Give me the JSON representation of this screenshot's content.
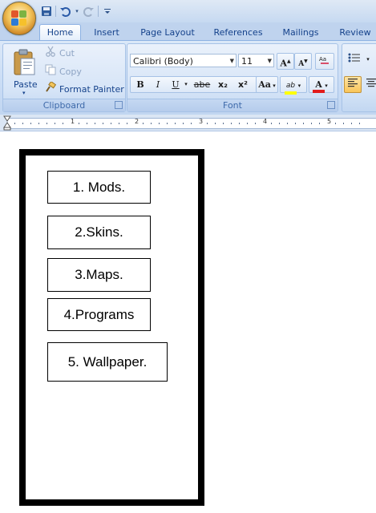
{
  "quick_access": {
    "icons": [
      "save-icon",
      "undo-icon",
      "redo-icon",
      "customize-icon"
    ]
  },
  "tabs": [
    {
      "label": "Home",
      "active": true
    },
    {
      "label": "Insert",
      "active": false
    },
    {
      "label": "Page Layout",
      "active": false
    },
    {
      "label": "References",
      "active": false
    },
    {
      "label": "Mailings",
      "active": false
    },
    {
      "label": "Review",
      "active": false
    }
  ],
  "clipboard": {
    "group_label": "Clipboard",
    "paste_label": "Paste",
    "cut_label": "Cut",
    "copy_label": "Copy",
    "format_painter_label": "Format Painter"
  },
  "font": {
    "group_label": "Font",
    "font_name": "Calibri (Body)",
    "font_size": "11",
    "grow_font": "A",
    "shrink_font": "A",
    "bold": "B",
    "italic": "I",
    "underline": "U",
    "strikethrough": "abe",
    "subscript": "x₂",
    "superscript": "x²",
    "change_case": "Aa",
    "highlight": "ab",
    "font_color": "A",
    "highlight_color": "#ffff00",
    "font_color_value": "#e21b1b"
  },
  "ruler": {
    "numbers": [
      "1",
      "2",
      "3",
      "4",
      "5"
    ]
  },
  "document": {
    "items": [
      "1. Mods.",
      "2.Skins.",
      "3.Maps.",
      "4.Programs",
      "5. Wallpaper."
    ]
  },
  "colors": {
    "accent": "#15428b",
    "ribbon": "#c9dcf5"
  }
}
